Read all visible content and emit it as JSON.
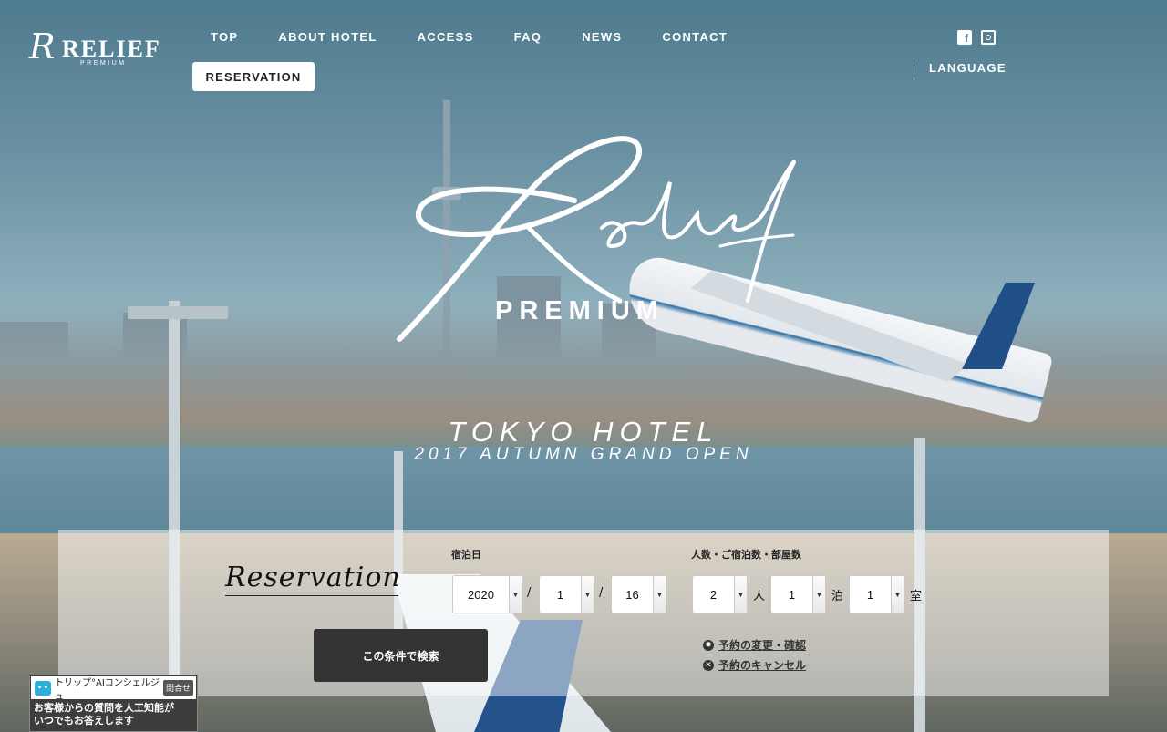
{
  "header": {
    "logo_mark": "R",
    "logo_word": "RELIEF",
    "logo_sub": "PREMIUM",
    "nav": [
      "TOP",
      "ABOUT HOTEL",
      "ACCESS",
      "FAQ",
      "NEWS",
      "CONTACT"
    ],
    "reservation_button": "RESERVATION",
    "language_label": "LANGUAGE",
    "social_icons": [
      "facebook-icon",
      "instagram-icon"
    ]
  },
  "hero": {
    "script_logo": "Relief",
    "premium": "PREMIUM",
    "title": "TOKYO HOTEL",
    "subtitle": "2017 AUTUMN GRAND OPEN"
  },
  "reservation": {
    "title": "Reservation",
    "date_label": "宿泊日",
    "year": "2020",
    "month": "1",
    "day": "16",
    "date_sep": "/",
    "guests_label": "人数・ご宿泊数・部屋数",
    "guests": "2",
    "guests_unit": "人",
    "nights": "1",
    "nights_unit": "泊",
    "rooms": "1",
    "rooms_unit": "室",
    "search_button": "この条件で検索",
    "change_link": "予約の変更・確認",
    "cancel_link": "予約のキャンセル"
  },
  "widget": {
    "name": "トリップ°AIコンシェルジュ",
    "button": "問合せ",
    "line1": "お客様からの質問を人工知能が",
    "line2": "いつでもお答えします"
  },
  "colors": {
    "panel_bg": "rgba(255,255,255,0.48)",
    "search_button": "#333333",
    "accent_blue": "#2ab0d8"
  }
}
